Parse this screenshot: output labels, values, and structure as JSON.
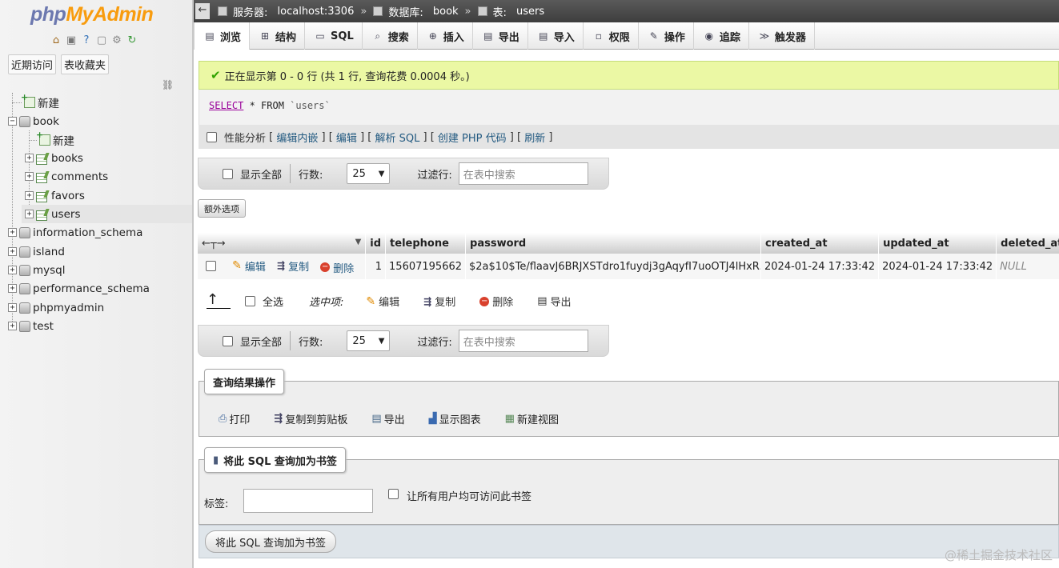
{
  "nav": {
    "logo_php": "php",
    "logo_myadmin": "MyAdmin",
    "tabs": [
      "近期访问",
      "表收藏夹"
    ],
    "tree": [
      {
        "label": "新建"
      },
      {
        "label": "book"
      },
      {
        "label": "新建"
      },
      {
        "label": "books"
      },
      {
        "label": "comments"
      },
      {
        "label": "favors"
      },
      {
        "label": "users"
      },
      {
        "label": "information_schema"
      },
      {
        "label": "island"
      },
      {
        "label": "mysql"
      },
      {
        "label": "performance_schema"
      },
      {
        "label": "phpmyadmin"
      },
      {
        "label": "test"
      }
    ]
  },
  "topbar": {
    "server_label": "服务器:",
    "server": "localhost:3306",
    "db_label": "数据库:",
    "db": "book",
    "table_label": "表:",
    "table": "users"
  },
  "tabs": [
    "浏览",
    "结构",
    "SQL",
    "搜索",
    "插入",
    "导出",
    "导入",
    "权限",
    "操作",
    "追踪",
    "触发器"
  ],
  "message": "正在显示第 0 - 0 行 (共 1 行, 查询花费 0.0004 秒。)",
  "sql": {
    "select": "SELECT",
    "rest": " * FROM ",
    "table": "`users`"
  },
  "sql_tools": {
    "profiling": "性能分析",
    "links": [
      "编辑内嵌",
      "编辑",
      "解析 SQL",
      "创建 PHP 代码",
      "刷新"
    ]
  },
  "navigation": {
    "show_all": "显示全部",
    "rows_label": "行数:",
    "rows_value": "25",
    "filter_label": "过滤行:",
    "filter_placeholder": "在表中搜索"
  },
  "extra_options": "额外选项",
  "grid": {
    "columns": [
      "id",
      "telephone",
      "password",
      "created_at",
      "updated_at",
      "deleted_at"
    ],
    "rows": [
      {
        "actions": [
          "编辑",
          "复制",
          "删除"
        ],
        "id": "1",
        "telephone": "15607195662",
        "password": "$2a$10$Te/flaavJ6BRJXSTdro1fuydj3gAqyfI7uoOTJ4lHxR...",
        "created_at": "2024-01-24 17:33:42",
        "updated_at": "2024-01-24 17:33:42",
        "deleted_at": "NULL"
      }
    ]
  },
  "with_selected": {
    "check_all": "全选",
    "label": "选中项:",
    "actions": [
      "编辑",
      "复制",
      "删除",
      "导出"
    ]
  },
  "query_ops": {
    "legend": "查询结果操作",
    "items": [
      "打印",
      "复制到剪贴板",
      "导出",
      "显示图表",
      "新建视图"
    ]
  },
  "bookmark": {
    "legend": "将此 SQL 查询加为书签",
    "label": "标签:",
    "share": "让所有用户均可访问此书签",
    "button": "将此 SQL 查询加为书签"
  },
  "watermark": "@稀土掘金技术社区"
}
